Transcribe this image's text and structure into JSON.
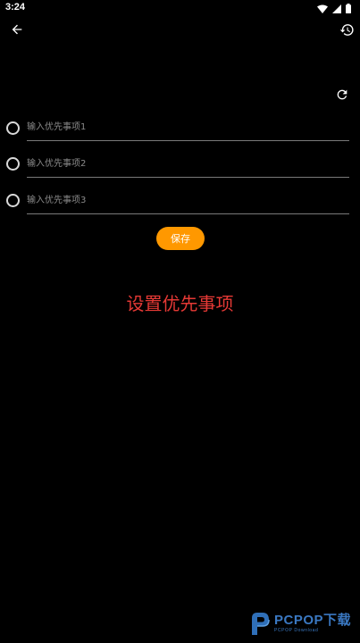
{
  "status_bar": {
    "time": "3:24",
    "icons": [
      "wifi-icon",
      "signal-icon",
      "battery-icon"
    ]
  },
  "toolbar": {
    "back_icon": "arrow-back-icon",
    "history_icon": "history-icon",
    "refresh_icon": "refresh-icon"
  },
  "priorities": {
    "items": [
      {
        "placeholder": "输入优先事项1",
        "value": ""
      },
      {
        "placeholder": "输入优先事项2",
        "value": ""
      },
      {
        "placeholder": "输入优先事项3",
        "value": ""
      }
    ]
  },
  "save_button": {
    "label": "保存"
  },
  "heading": {
    "text": "设置优先事项"
  },
  "watermark": {
    "brand": "PCPOP",
    "brand_cn": "下载",
    "sub": "PCPOP Download"
  },
  "colors": {
    "background": "#000000",
    "accent": "#ff9800",
    "heading": "#e53935",
    "watermark": "#3a78c2"
  }
}
